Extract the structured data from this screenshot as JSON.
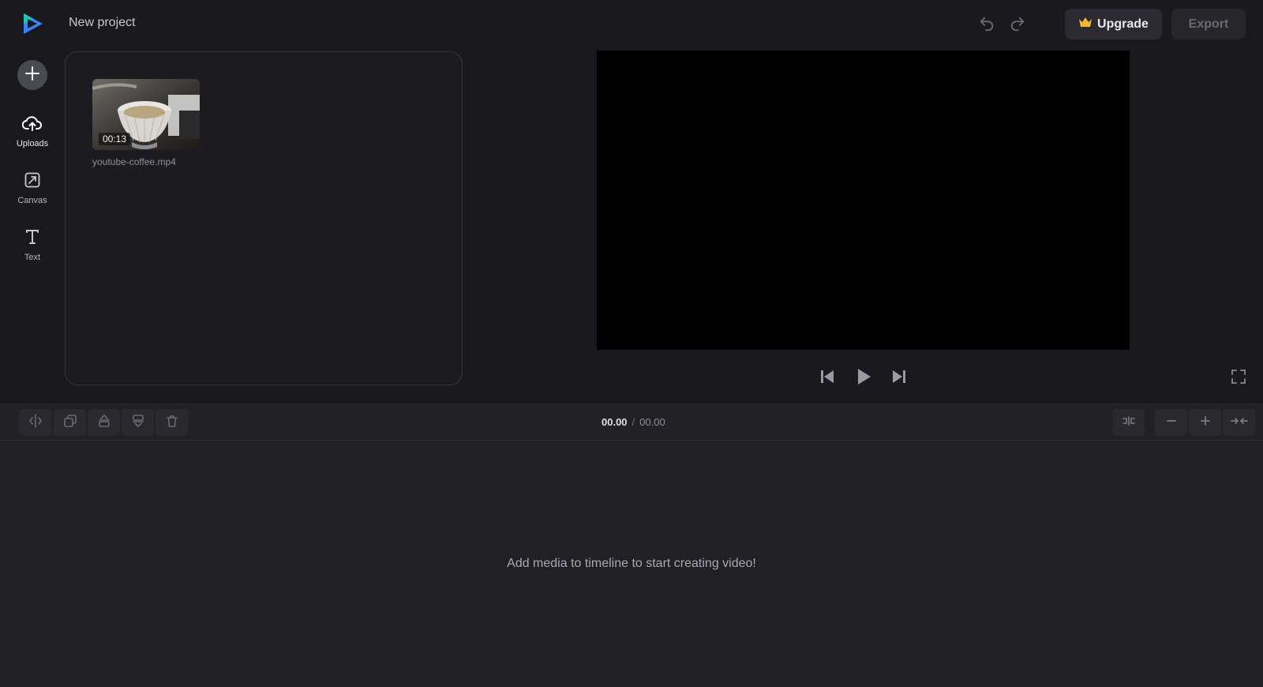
{
  "header": {
    "project_title": "New project",
    "undo_icon": "undo-icon",
    "redo_icon": "redo-icon",
    "upgrade_label": "Upgrade",
    "export_label": "Export",
    "brand_colors": {
      "logo_blue": "#3b82f6",
      "logo_teal": "#22c3b5",
      "crown": "#f5b82e"
    }
  },
  "sidebar": {
    "add_icon": "plus-icon",
    "items": [
      {
        "label": "Uploads",
        "icon": "upload-cloud-icon",
        "active": true
      },
      {
        "label": "Canvas",
        "icon": "canvas-resize-icon",
        "active": false
      },
      {
        "label": "Text",
        "icon": "text-icon",
        "active": false
      }
    ]
  },
  "media": {
    "items": [
      {
        "file_name": "youtube-coffee.mp4",
        "duration": "00:13"
      }
    ]
  },
  "player": {
    "controls": [
      "skip-back-icon",
      "play-icon",
      "skip-forward-icon"
    ],
    "fullscreen_icon": "fullscreen-icon"
  },
  "timeline": {
    "tools": [
      "split-icon",
      "duplicate-icon",
      "move-up-icon",
      "move-down-icon",
      "delete-icon"
    ],
    "current_time": "00.00",
    "separator": "/",
    "total_time": "00.00",
    "zoom_tools": [
      "fit-icon",
      "zoom-out-icon",
      "zoom-in-icon",
      "collapse-icon"
    ],
    "empty_message": "Add media to timeline to start creating video!"
  }
}
